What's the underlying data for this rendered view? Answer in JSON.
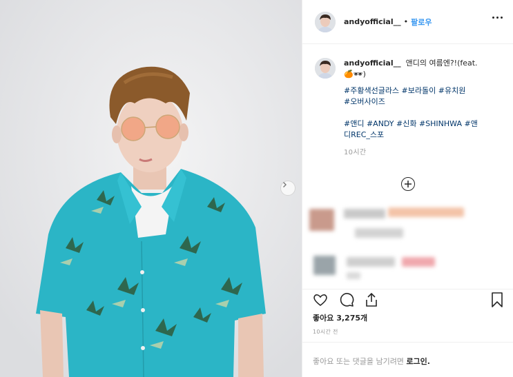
{
  "header": {
    "username": "andyofficial__",
    "separator": "•",
    "follow_label": "팔로우"
  },
  "caption": {
    "username": "andyofficial__",
    "text": "앤디의 여름엔?!(feat.",
    "emoji": "🍊🕶)",
    "hashtags_line1": "#주황색선글라스 #보라돌이 #유치원",
    "hashtags_line2": "#오버사이즈",
    "hashtags_line3": "#앤디 #ANDY #신화 #SHINHWA #앤",
    "hashtags_line4": "디REC_스포",
    "time": "10시간"
  },
  "likes": {
    "label": "좋아요",
    "count": "3,275개"
  },
  "post_time": "10시간 전",
  "login_prompt": {
    "text": "좋아요 또는 댓글을 남기려면",
    "link": "로그인."
  },
  "colors": {
    "shirt": "#2bb5c6",
    "link": "#003569",
    "follow": "#3897f0",
    "muted": "#999999"
  },
  "icons": [
    "chevron-right-icon",
    "more-icon",
    "plus-circle-icon",
    "heart-icon",
    "comment-icon",
    "share-icon",
    "bookmark-icon"
  ]
}
